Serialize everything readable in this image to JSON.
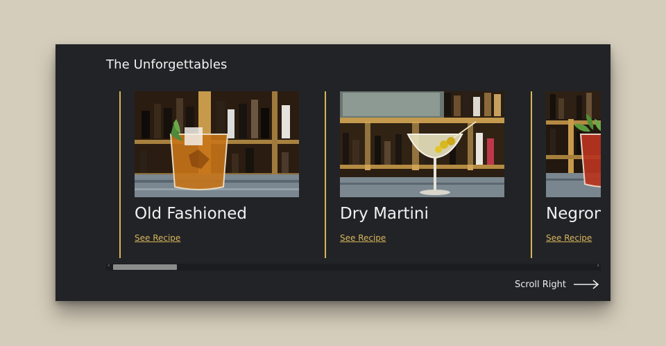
{
  "section": {
    "title": "The Unforgettables"
  },
  "cards": [
    {
      "name": "Old Fashioned",
      "link_label": "See Recipe",
      "image": "old-fashioned-photo"
    },
    {
      "name": "Dry Martini",
      "link_label": "See Recipe",
      "image": "dry-martini-photo"
    },
    {
      "name": "Negroni",
      "link_label": "See Recipe",
      "image": "negroni-photo"
    }
  ],
  "scrollbar": {
    "position_fraction": 0.0,
    "visible_fraction": 0.13
  },
  "scroll_hint": {
    "label": "Scroll Right",
    "icon": "arrow-right-icon"
  },
  "colors": {
    "accent": "#d7b55b",
    "panel": "#222326",
    "page": "#d5cdbb"
  }
}
